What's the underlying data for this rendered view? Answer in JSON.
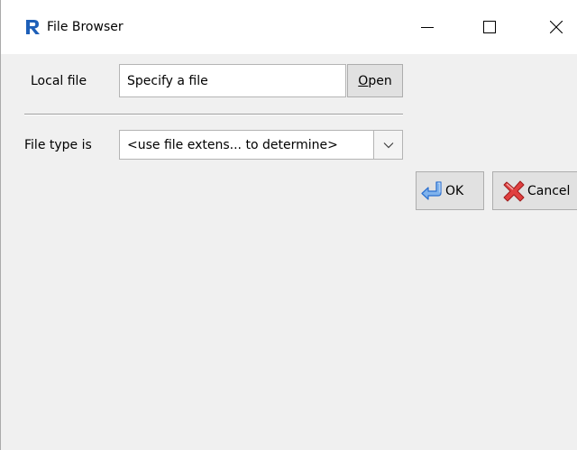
{
  "window": {
    "title": "File Browser",
    "app_icon": "r-logo-icon",
    "controls": {
      "minimize": "minimize-icon",
      "maximize": "maximize-icon",
      "close": "close-icon"
    }
  },
  "form": {
    "local_file_label": "Local file",
    "local_file_placeholder": "Specify a file",
    "open_button_mnemonic": "O",
    "open_button_rest": "pen",
    "file_type_label": "File type is",
    "file_type_selected": "<use file extens... to determine>"
  },
  "actions": {
    "ok_label": "OK",
    "ok_icon": "return-arrow-icon",
    "cancel_label": "Cancel",
    "cancel_icon": "red-x-icon"
  },
  "colors": {
    "accent_blue": "#2a6fcf",
    "cancel_red": "#e04040",
    "background": "#f0f0f0"
  }
}
